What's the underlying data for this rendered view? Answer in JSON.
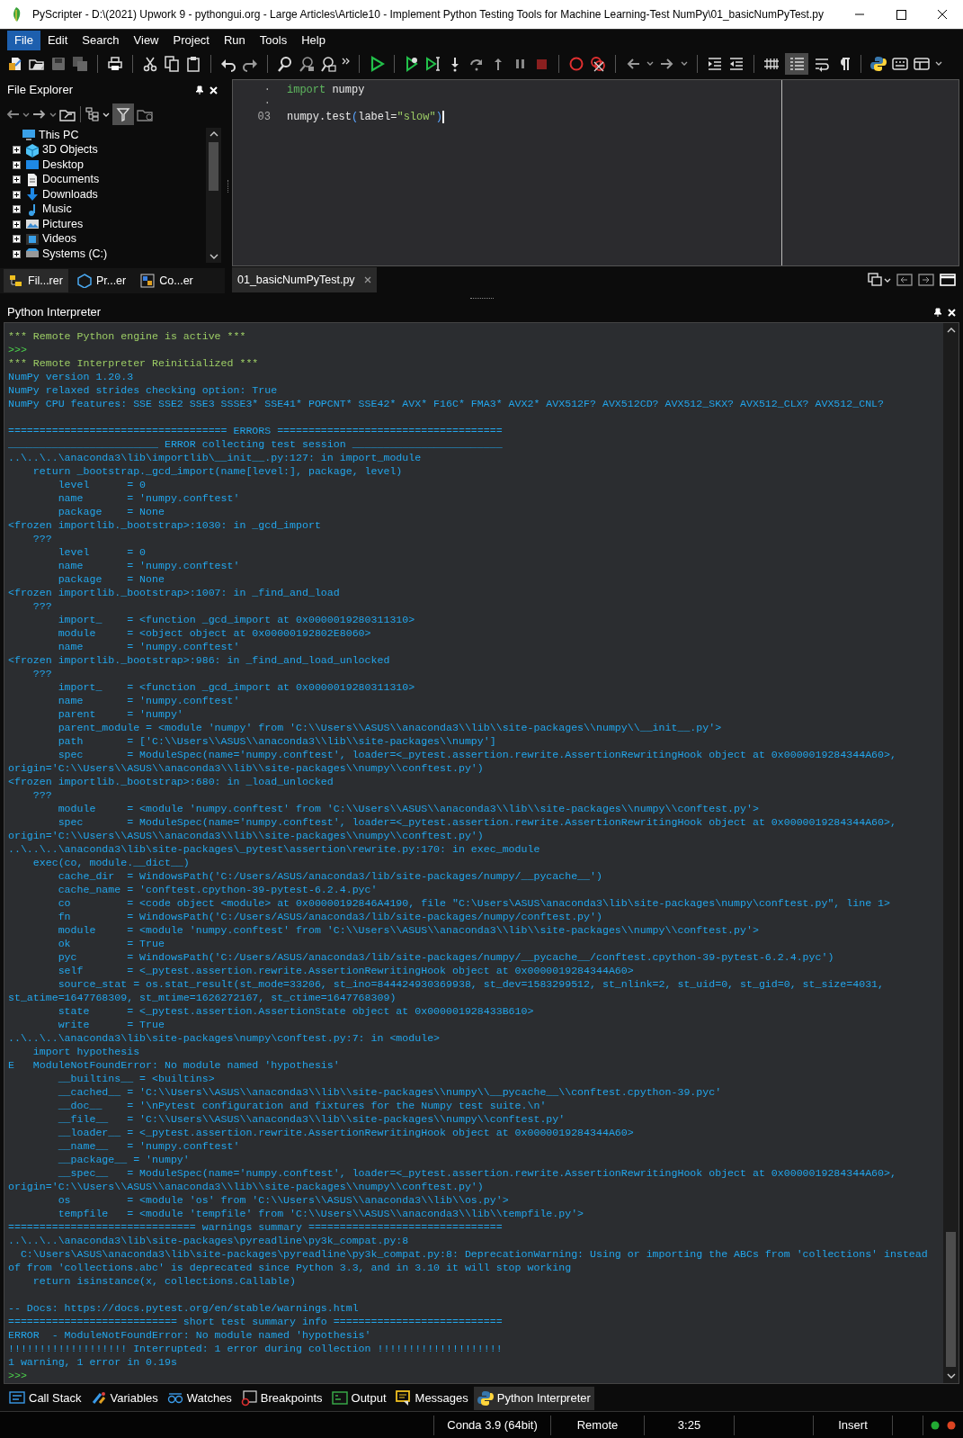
{
  "window": {
    "title": "PyScripter - D:\\(2021) Upwork 9 - pythongui.org - Large Articles\\Article10 - Implement Python Testing Tools for Machine Learning-Test NumPy\\01_basicNumPyTest.py"
  },
  "menu_bar": [
    {
      "label": "File",
      "selected": true
    },
    {
      "label": "Edit",
      "selected": false
    },
    {
      "label": "Search",
      "selected": false
    },
    {
      "label": "View",
      "selected": false
    },
    {
      "label": "Project",
      "selected": false
    },
    {
      "label": "Run",
      "selected": false
    },
    {
      "label": "Tools",
      "selected": false
    },
    {
      "label": "Help",
      "selected": false
    }
  ],
  "toolbar": {
    "list_toggle_on": true
  },
  "file_explorer": {
    "title": "File Explorer",
    "filter_on": true,
    "tree": [
      {
        "label": "This PC",
        "children": [
          {
            "label": "3D Objects",
            "expanded": false
          },
          {
            "label": "Desktop",
            "expanded": false
          },
          {
            "label": "Documents",
            "expanded": false
          },
          {
            "label": "Downloads",
            "expanded": false
          },
          {
            "label": "Music",
            "expanded": false
          },
          {
            "label": "Pictures",
            "expanded": false
          },
          {
            "label": "Videos",
            "expanded": false
          },
          {
            "label": "Systems (C:)",
            "expanded": false
          }
        ]
      }
    ],
    "tabs": [
      {
        "label": "Fil...rer",
        "selected": true
      },
      {
        "label": "Pr...er",
        "selected": false
      },
      {
        "label": "Co...er",
        "selected": false
      }
    ]
  },
  "editor": {
    "lines": [
      {
        "number": "·",
        "tokens": [
          {
            "kind": "keyword",
            "text": "import"
          },
          {
            "kind": "plain",
            "text": " numpy"
          }
        ]
      },
      {
        "number": "·"
      },
      {
        "number": "03",
        "tokens": [
          {
            "kind": "plain",
            "text": "numpy.test"
          },
          {
            "kind": "paren",
            "text": "("
          },
          {
            "kind": "plain",
            "text": "label="
          },
          {
            "kind": "string",
            "text": "\"slow\""
          },
          {
            "kind": "paren",
            "text": ")"
          }
        ]
      }
    ],
    "tabs": [
      {
        "label": "01_basicNumPyTest.py",
        "selected": true
      }
    ]
  },
  "interpreter": {
    "title": "Python Interpreter",
    "lines": [
      {
        "kind": "system",
        "text": "*** Remote Python engine is active ***"
      },
      {
        "kind": "prompt",
        "text": ">>>"
      },
      {
        "kind": "system",
        "text": "*** Remote Interpreter Reinitialized ***"
      },
      {
        "kind": "output",
        "text": "NumPy version 1.20.3"
      },
      {
        "kind": "output",
        "text": "NumPy relaxed strides checking option: True"
      },
      {
        "kind": "output",
        "text": "NumPy CPU features: SSE SSE2 SSE3 SSSE3* SSE41* POPCNT* SSE42* AVX* F16C* FMA3* AVX2* AVX512F? AVX512CD? AVX512_SKX? AVX512_CLX? AVX512_CNL?"
      },
      {
        "kind": "blank"
      },
      {
        "kind": "output",
        "text": "=================================== ERRORS ===================================="
      },
      {
        "kind": "output",
        "text": "________________________ ERROR collecting test session ________________________"
      },
      {
        "kind": "output",
        "text": "..\\..\\..\\anaconda3\\lib\\importlib\\__init__.py:127: in import_module"
      },
      {
        "kind": "output",
        "text": "    return _bootstrap._gcd_import(name[level:], package, level)"
      },
      {
        "kind": "output",
        "text": "        level      = 0"
      },
      {
        "kind": "output",
        "text": "        name       = 'numpy.conftest'"
      },
      {
        "kind": "output",
        "text": "        package    = None"
      },
      {
        "kind": "output",
        "text": "<frozen importlib._bootstrap>:1030: in _gcd_import"
      },
      {
        "kind": "output",
        "text": "    ???"
      },
      {
        "kind": "output",
        "text": "        level      = 0"
      },
      {
        "kind": "output",
        "text": "        name       = 'numpy.conftest'"
      },
      {
        "kind": "output",
        "text": "        package    = None"
      },
      {
        "kind": "output",
        "text": "<frozen importlib._bootstrap>:1007: in _find_and_load"
      },
      {
        "kind": "output",
        "text": "    ???"
      },
      {
        "kind": "output",
        "text": "        import_    = <function _gcd_import at 0x0000019280311310>"
      },
      {
        "kind": "output",
        "text": "        module     = <object object at 0x00000192802E8060>"
      },
      {
        "kind": "output",
        "text": "        name       = 'numpy.conftest'"
      },
      {
        "kind": "output",
        "text": "<frozen importlib._bootstrap>:986: in _find_and_load_unlocked"
      },
      {
        "kind": "output",
        "text": "    ???"
      },
      {
        "kind": "output",
        "text": "        import_    = <function _gcd_import at 0x0000019280311310>"
      },
      {
        "kind": "output",
        "text": "        name       = 'numpy.conftest'"
      },
      {
        "kind": "output",
        "text": "        parent     = 'numpy'"
      },
      {
        "kind": "output",
        "text": "        parent_module = <module 'numpy' from 'C:\\\\Users\\\\ASUS\\\\anaconda3\\\\lib\\\\site-packages\\\\numpy\\\\__init__.py'>"
      },
      {
        "kind": "output",
        "text": "        path       = ['C:\\\\Users\\\\ASUS\\\\anaconda3\\\\lib\\\\site-packages\\\\numpy']"
      },
      {
        "kind": "output",
        "text": "        spec       = ModuleSpec(name='numpy.conftest', loader=<_pytest.assertion.rewrite.AssertionRewritingHook object at 0x0000019284344A60>,"
      },
      {
        "kind": "output",
        "text": "origin='C:\\\\Users\\\\ASUS\\\\anaconda3\\\\lib\\\\site-packages\\\\numpy\\\\conftest.py')"
      },
      {
        "kind": "output",
        "text": "<frozen importlib._bootstrap>:680: in _load_unlocked"
      },
      {
        "kind": "output",
        "text": "    ???"
      },
      {
        "kind": "output",
        "text": "        module     = <module 'numpy.conftest' from 'C:\\\\Users\\\\ASUS\\\\anaconda3\\\\lib\\\\site-packages\\\\numpy\\\\conftest.py'>"
      },
      {
        "kind": "output",
        "text": "        spec       = ModuleSpec(name='numpy.conftest', loader=<_pytest.assertion.rewrite.AssertionRewritingHook object at 0x0000019284344A60>,"
      },
      {
        "kind": "output",
        "text": "origin='C:\\\\Users\\\\ASUS\\\\anaconda3\\\\lib\\\\site-packages\\\\numpy\\\\conftest.py')"
      },
      {
        "kind": "output",
        "text": "..\\..\\..\\anaconda3\\lib\\site-packages\\_pytest\\assertion\\rewrite.py:170: in exec_module"
      },
      {
        "kind": "output",
        "text": "    exec(co, module.__dict__)"
      },
      {
        "kind": "output",
        "text": "        cache_dir  = WindowsPath('C:/Users/ASUS/anaconda3/lib/site-packages/numpy/__pycache__')"
      },
      {
        "kind": "output",
        "text": "        cache_name = 'conftest.cpython-39-pytest-6.2.4.pyc'"
      },
      {
        "kind": "output",
        "text": "        co         = <code object <module> at 0x00000192846A4190, file \"C:\\Users\\ASUS\\anaconda3\\lib\\site-packages\\numpy\\conftest.py\", line 1>"
      },
      {
        "kind": "output",
        "text": "        fn         = WindowsPath('C:/Users/ASUS/anaconda3/lib/site-packages/numpy/conftest.py')"
      },
      {
        "kind": "output",
        "text": "        module     = <module 'numpy.conftest' from 'C:\\\\Users\\\\ASUS\\\\anaconda3\\\\lib\\\\site-packages\\\\numpy\\\\conftest.py'>"
      },
      {
        "kind": "output",
        "text": "        ok         = True"
      },
      {
        "kind": "output",
        "text": "        pyc        = WindowsPath('C:/Users/ASUS/anaconda3/lib/site-packages/numpy/__pycache__/conftest.cpython-39-pytest-6.2.4.pyc')"
      },
      {
        "kind": "output",
        "text": "        self       = <_pytest.assertion.rewrite.AssertionRewritingHook object at 0x0000019284344A60>"
      },
      {
        "kind": "output",
        "text": "        source_stat = os.stat_result(st_mode=33206, st_ino=844424930369938, st_dev=1583299512, st_nlink=2, st_uid=0, st_gid=0, st_size=4031,"
      },
      {
        "kind": "output",
        "text": "st_atime=1647768309, st_mtime=1626272167, st_ctime=1647768309)"
      },
      {
        "kind": "output",
        "text": "        state      = <_pytest.assertion.AssertionState object at 0x000001928433B610>"
      },
      {
        "kind": "output",
        "text": "        write      = True"
      },
      {
        "kind": "output",
        "text": "..\\..\\..\\anaconda3\\lib\\site-packages\\numpy\\conftest.py:7: in <module>"
      },
      {
        "kind": "output",
        "text": "    import hypothesis"
      },
      {
        "kind": "output",
        "text": "E   ModuleNotFoundError: No module named 'hypothesis'"
      },
      {
        "kind": "output",
        "text": "        __builtins__ = <builtins>"
      },
      {
        "kind": "output",
        "text": "        __cached__ = 'C:\\\\Users\\\\ASUS\\\\anaconda3\\\\lib\\\\site-packages\\\\numpy\\\\__pycache__\\\\conftest.cpython-39.pyc'"
      },
      {
        "kind": "output",
        "text": "        __doc__    = '\\nPytest configuration and fixtures for the Numpy test suite.\\n'"
      },
      {
        "kind": "output",
        "text": "        __file__   = 'C:\\\\Users\\\\ASUS\\\\anaconda3\\\\lib\\\\site-packages\\\\numpy\\\\conftest.py'"
      },
      {
        "kind": "output",
        "text": "        __loader__ = <_pytest.assertion.rewrite.AssertionRewritingHook object at 0x0000019284344A60>"
      },
      {
        "kind": "output",
        "text": "        __name__   = 'numpy.conftest'"
      },
      {
        "kind": "output",
        "text": "        __package__ = 'numpy'"
      },
      {
        "kind": "output",
        "text": "        __spec__   = ModuleSpec(name='numpy.conftest', loader=<_pytest.assertion.rewrite.AssertionRewritingHook object at 0x0000019284344A60>,"
      },
      {
        "kind": "output",
        "text": "origin='C:\\\\Users\\\\ASUS\\\\anaconda3\\\\lib\\\\site-packages\\\\numpy\\\\conftest.py')"
      },
      {
        "kind": "output",
        "text": "        os         = <module 'os' from 'C:\\\\Users\\\\ASUS\\\\anaconda3\\\\lib\\\\os.py'>"
      },
      {
        "kind": "output",
        "text": "        tempfile   = <module 'tempfile' from 'C:\\\\Users\\\\ASUS\\\\anaconda3\\\\lib\\\\tempfile.py'>"
      },
      {
        "kind": "output",
        "text": "============================== warnings summary ==============================="
      },
      {
        "kind": "output",
        "text": "..\\..\\..\\anaconda3\\lib\\site-packages\\pyreadline\\py3k_compat.py:8"
      },
      {
        "kind": "output",
        "text": "  C:\\Users\\ASUS\\anaconda3\\lib\\site-packages\\pyreadline\\py3k_compat.py:8: DeprecationWarning: Using or importing the ABCs from 'collections' instead"
      },
      {
        "kind": "output",
        "text": "of from 'collections.abc' is deprecated since Python 3.3, and in 3.10 it will stop working"
      },
      {
        "kind": "output",
        "text": "    return isinstance(x, collections.Callable)"
      },
      {
        "kind": "blank"
      },
      {
        "kind": "output",
        "text": "-- Docs: https://docs.pytest.org/en/stable/warnings.html"
      },
      {
        "kind": "output",
        "text": "=========================== short test summary info ==========================="
      },
      {
        "kind": "output",
        "text": "ERROR  - ModuleNotFoundError: No module named 'hypothesis'"
      },
      {
        "kind": "output",
        "text": "!!!!!!!!!!!!!!!!!!! Interrupted: 1 error during collection !!!!!!!!!!!!!!!!!!!!"
      },
      {
        "kind": "output",
        "text": "1 warning, 1 error in 0.19s"
      },
      {
        "kind": "prompt",
        "text": ">>>"
      }
    ]
  },
  "bottom_tabs": [
    {
      "label": "Call Stack",
      "selected": false
    },
    {
      "label": "Variables",
      "selected": false
    },
    {
      "label": "Watches",
      "selected": false
    },
    {
      "label": "Breakpoints",
      "selected": false
    },
    {
      "label": "Output",
      "selected": false
    },
    {
      "label": "Messages",
      "selected": false
    },
    {
      "label": "Python Interpreter",
      "selected": true
    }
  ],
  "status_bar": {
    "cells": [
      "Conda 3.9 (64bit)",
      "Remote",
      "3:25",
      "Insert"
    ],
    "lights": [
      {
        "color": "#22aa33"
      },
      {
        "color": "#dd4422"
      }
    ]
  }
}
